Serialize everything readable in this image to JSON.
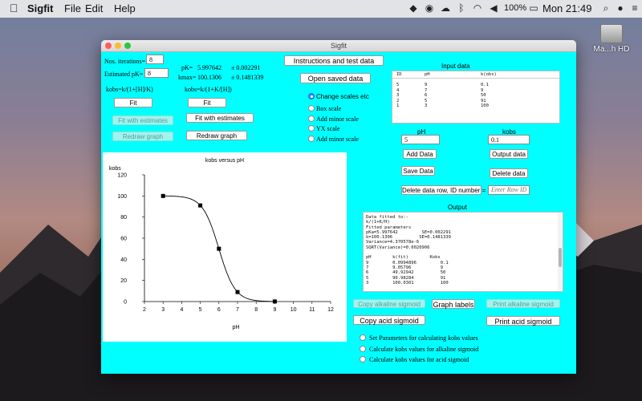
{
  "menubar": {
    "app_name": "Sigfit",
    "menus": [
      "File",
      "Edit",
      "Help"
    ],
    "battery": "100%",
    "clock": "Mon 21:49"
  },
  "desktop": {
    "disk_label": "Ma...h HD"
  },
  "window": {
    "title": "Sigfit",
    "iterations_label": "Nos. iterations=",
    "iterations_value": "8",
    "estimated_pk_label": "Estimated pK=",
    "estimated_pk_value": "8",
    "pk_label": "pK=",
    "pk_value": "5.997642",
    "pk_err": "± 0.002291",
    "kmax_label": "kmax=",
    "kmax_value": "100.1306",
    "kmax_err": "± 0.1481339",
    "alk_eq": "kobs=k/(1+[H]/K)",
    "acid_eq": "kobs=k/(1+K/[H])",
    "fit_label": "Fit",
    "fit_estimates_label": "Fit with estimates",
    "redraw_label": "Redraw graph",
    "instructions_label": "Instructions and test data",
    "open_saved_label": "Open saved data",
    "scale_options": [
      "Change scales etc",
      "Box scale",
      "Add minor scale",
      "YX scale",
      "Add minor scale"
    ],
    "input_title": "Input data",
    "input_headers": [
      "ID",
      "pH",
      "k(obs)"
    ],
    "input_rows": [
      [
        "5",
        "9",
        "0.1"
      ],
      [
        "4",
        "7",
        "9"
      ],
      [
        "3",
        "6",
        "50"
      ],
      [
        "2",
        "5",
        "91"
      ],
      [
        "1",
        "3",
        "100"
      ]
    ],
    "ph_label": "pH",
    "ph_value": "5",
    "kobs_label": "kobs",
    "kobs_value": "0.1",
    "add_data_label": "Add Data",
    "output_data_label": "Output data",
    "save_data_label": "Save Data",
    "delete_data_label": "Delete data",
    "delete_row_label": "Delete data row, ID number =",
    "row_id_placeholder": "Enter Row ID",
    "output_title": "Output",
    "output_text": "Data fitted to:-\nk/(1+K/H)\nFitted parameters\npKa=5.997642         SE=0.002291\nk=100.1306          SE=0.1481339\nVariance=4.370578e-6\nSQRT(Variance)=0.0020906\n\npH        k(fit)        Kobs\n9         0.0994896         0.1\n7         9.05796           9\n6         49.92942          50\n5         90.98284          91\n3         100.0301          100",
    "copy_alk_label": "Copy alkaline sigmoid",
    "graph_labels_label": "Graph labels",
    "print_alk_label": "Print alkaline sigmoid",
    "copy_acid_label": "Copy acid sigmoid",
    "print_acid_label": "Print acid sigmoid",
    "calc_options": [
      "Set Parameters for calculating kobs values",
      "Calculate kobs values for alkaline sigmoid",
      "Calculate kobs values for acid sigmoid"
    ]
  },
  "chart_data": {
    "type": "scatter",
    "title": "kobs versus pH",
    "xlabel": "pH",
    "ylabel": "kobs",
    "xlim": [
      2,
      12
    ],
    "ylim": [
      0,
      120
    ],
    "xticks": [
      2,
      3,
      4,
      5,
      6,
      7,
      8,
      9,
      10,
      11,
      12
    ],
    "yticks": [
      0,
      20,
      40,
      60,
      80,
      100,
      120
    ],
    "points": [
      {
        "x": 3,
        "y": 100
      },
      {
        "x": 5,
        "y": 91
      },
      {
        "x": 6,
        "y": 50
      },
      {
        "x": 7,
        "y": 9
      },
      {
        "x": 9,
        "y": 0.1
      }
    ],
    "fit": {
      "pK": 5.997642,
      "k": 100.1306
    }
  }
}
